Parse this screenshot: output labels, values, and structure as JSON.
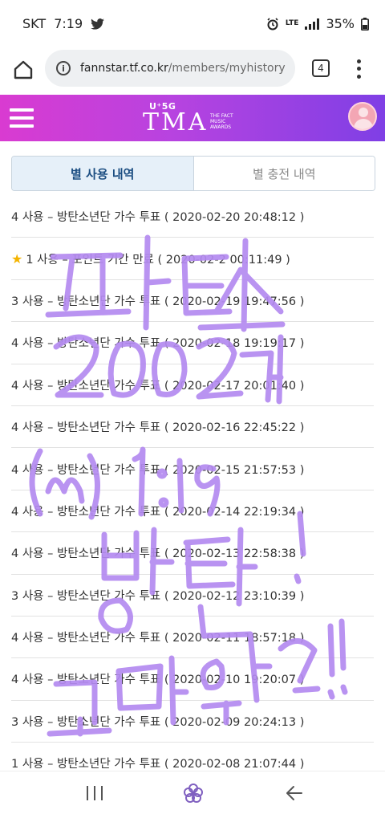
{
  "status_bar": {
    "carrier": "SKT",
    "time": "7:19",
    "signal": "LTE",
    "battery": "35%"
  },
  "browser": {
    "url_host": "fannstar.tf.co.kr",
    "url_path": "/members/myhistory",
    "tab_count": "4"
  },
  "header": {
    "logo_badge": "U⁺5G",
    "logo_text": "TMA",
    "logo_sub": "THE FACT MUSIC AWARDS"
  },
  "tabs": {
    "used": "별 사용 내역",
    "charged": "별 충전 내역"
  },
  "history": [
    {
      "text": "4 사용 – 방탄소년단 가수 투표 ( 2020-02-20 20:48:12 )",
      "star": false
    },
    {
      "text": "1 사용 – 포인트 기간 만료 ( 2020-02-2  00:11:49 )",
      "star": true
    },
    {
      "text": "3 사용 – 방탄소년단 가수 투표 ( 2020-02-19 19:47:56 )",
      "star": false
    },
    {
      "text": "4 사용 – 방탄소년단 가수 투표 ( 2020-02-18 19:19:17 )",
      "star": false
    },
    {
      "text": "4 사용 – 방탄소년단 가수 투표 ( 2020-02-17 20:01:40 )",
      "star": false
    },
    {
      "text": "4 사용 – 방탄소년단 가수 투표 ( 2020-02-16 22:45:22 )",
      "star": false
    },
    {
      "text": "4 사용 – 방탄소년단 가수 투표 ( 2020-02-15 21:57:53 )",
      "star": false
    },
    {
      "text": "4 사용 – 방탄소년단 가수 투표 ( 2020-02-14 22:19:34 )",
      "star": false
    },
    {
      "text": "4 사용 – 방탄소년단 가수 투표 ( 2020-02-13 22:58:38 )",
      "star": false
    },
    {
      "text": "3 사용 – 방탄소년단 가수 투표 ( 2020-02-12 23:10:39 )",
      "star": false
    },
    {
      "text": "4 사용 – 방탄소년단 가수 투표 ( 2020-02-11 18:57:18 )",
      "star": false
    },
    {
      "text": "4 사용 – 방탄소년단 가수 투표 ( 2020-02-10 19:20:07 )",
      "star": false
    },
    {
      "text": "3 사용 – 방탄소년단 가수 투표 ( 2020-02-09 20:24:13 )",
      "star": false
    },
    {
      "text": "1 사용 – 방탄소년단 가수 투표 ( 2020-02-08 21:07:44 )",
      "star": false
    }
  ],
  "colors": {
    "header_start": "#d93bd1",
    "header_end": "#7f3fe5",
    "active_tab_bg": "#e6f0f9",
    "active_tab_text": "#1c4e82",
    "scribble": "#b07cf0"
  }
}
